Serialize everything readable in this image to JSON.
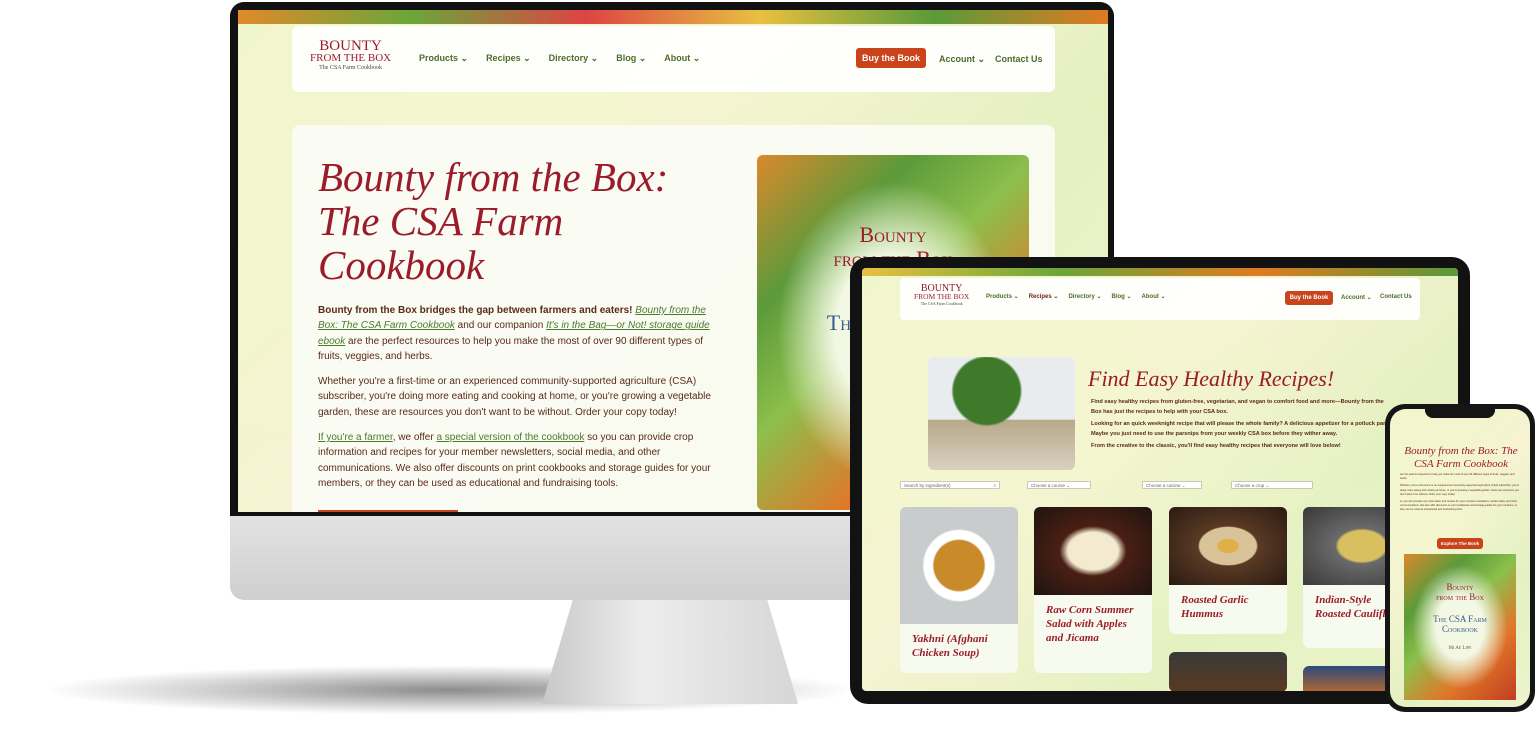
{
  "brand": {
    "line1": "BOUNTY",
    "line2": "FROM THE BOX",
    "tagline": "The CSA Farm Cookbook"
  },
  "nav": {
    "items": [
      "Products",
      "Recipes",
      "Directory",
      "Blog",
      "About"
    ],
    "buy": "Buy the Book",
    "account": "Account",
    "contact": "Contact Us"
  },
  "desktop": {
    "title": "Bounty from the Box: The CSA Farm Cookbook",
    "p1_bold": "Bounty from the Box bridges the gap between farmers and eaters!",
    "p1_link1": "Bounty from the Box: The CSA Farm Cookbook",
    "p1_mid": " and our companion ",
    "p1_link2": "It's in the Bag—or Not! storage guide ebook",
    "p1_end": " are the perfect resources to help you make the most of over 90 different types of fruits, veggies, and herbs.",
    "p2": "Whether you're a first-time or an experienced community-supported agriculture (CSA) subscriber, you're doing more eating and cooking at home, or you're growing a vegetable garden, these are resources you don't want to be without. Order your copy today!",
    "p3_link1": "If you're a farmer",
    "p3_mid": ", we offer ",
    "p3_link2": "a special version of the cookbook",
    "p3_end": " so you can provide crop information and recipes for your member newsletters, social media, and other communications. We also offer discounts on print cookbooks and storage guides for your members, or they can be used as educational and fundraising tools."
  },
  "cover": {
    "title1": "Bounty",
    "title2": "from the Box",
    "subtitle1": "The CSA Farm",
    "subtitle2": "Cookbook",
    "author": "Mi Ae Lipe"
  },
  "tablet": {
    "title": "Find Easy Healthy Recipes!",
    "p1": "Find easy healthy recipes from gluten-free, vegetarian, and vegan to comfort food and more—Bounty from the Box has just the recipes to help with your CSA box.",
    "p2": "Looking for an quick weeknight recipe that will please the whole family? A delicious appetizer for a potluck party? Maybe you just need to use the parsnips from your weekly CSA box before they wither away.",
    "p3": "From the creative to the classic, you'll find easy healthy recipes that everyone will love below!",
    "search_placeholder": "Search by ingredient(s)",
    "filters": [
      "Choose a course",
      "Choose a cuisine",
      "Choose a crop"
    ],
    "recipes": [
      "Yakhni (Afghani Chicken Soup)",
      "Raw Corn Summer Salad with Apples and Jicama",
      "Roasted Garlic Hummus",
      "Indian-Style Roasted Cauliflower"
    ]
  },
  "phone": {
    "title": "Bounty from the Box: The CSA Farm Cookbook",
    "button": "Explore The Book"
  },
  "colors": {
    "accent": "#9b1b2a",
    "nav": "#4e6b2c",
    "button": "#c9431b"
  }
}
